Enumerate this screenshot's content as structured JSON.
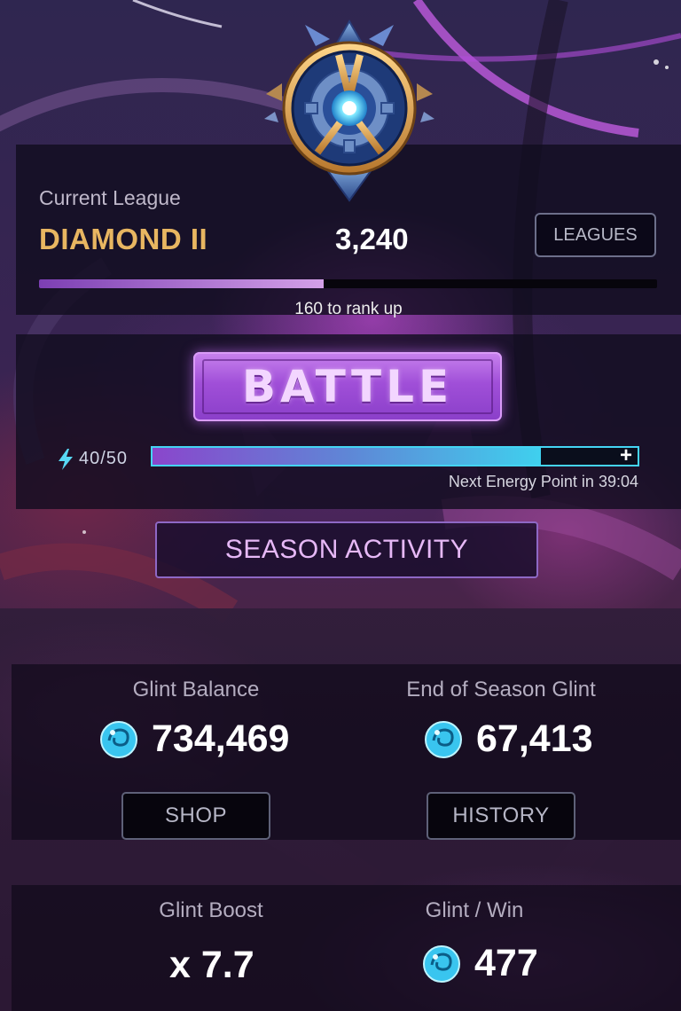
{
  "league": {
    "caption": "Current League",
    "name": "DIAMOND II",
    "points": "3,240",
    "leagues_button": "LEAGUES",
    "rank_progress": 0.46,
    "rank_caption": "160 to rank up"
  },
  "battle": {
    "button_label": "BATTLE",
    "energy_text": "40/50",
    "energy_fraction": 0.8,
    "plus_label": "+",
    "timer_text": "Next Energy Point in  39:04"
  },
  "season": {
    "button_label": "SEASON ACTIVITY"
  },
  "glint": {
    "balance_label": "Glint Balance",
    "balance_value": "734,469",
    "end_label": "End of Season Glint",
    "end_value": "67,413",
    "shop_button": "SHOP",
    "history_button": "HISTORY"
  },
  "boost": {
    "boost_label": "Glint Boost",
    "boost_value": "x 7.7",
    "per_win_label": "Glint / Win",
    "per_win_value": "477"
  },
  "icons": {
    "league_emblem": "diamond-league-emblem",
    "energy": "lightning-icon",
    "glint": "glint-orb-icon"
  },
  "colors": {
    "league_gold": "#e8b661",
    "battle_purple": "#a04fd8",
    "energy_cyan": "#3fd0ee",
    "season_text": "#e6b8f6"
  }
}
